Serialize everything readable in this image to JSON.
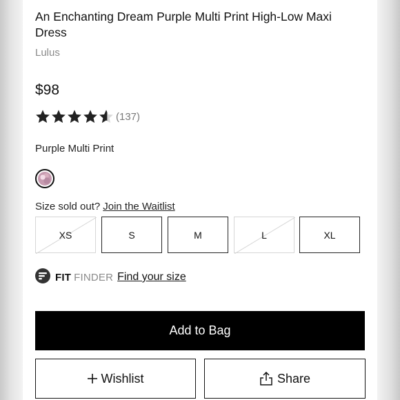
{
  "product": {
    "title": "An Enchanting Dream Purple Multi Print High-Low Maxi Dress",
    "brand": "Lulus",
    "price": "$98",
    "rating": 4.6,
    "rating_count": "(137)",
    "color_name": "Purple Multi Print"
  },
  "sizes": {
    "sold_out_text": "Size sold out?",
    "waitlist_link": "Join the Waitlist",
    "options": [
      {
        "label": "XS",
        "sold_out": true
      },
      {
        "label": "S",
        "sold_out": false
      },
      {
        "label": "M",
        "sold_out": false
      },
      {
        "label": "L",
        "sold_out": true
      },
      {
        "label": "XL",
        "sold_out": false
      }
    ]
  },
  "fit_finder": {
    "brand_bold": "FIT",
    "brand_light": "FINDER",
    "link": "Find your size"
  },
  "actions": {
    "add_to_bag": "Add to Bag",
    "wishlist": "Wishlist",
    "share": "Share"
  },
  "colors": {
    "text": "#111111",
    "muted": "#8a8a8a",
    "button_bg": "#000000",
    "sold_out_border": "#d6d6d6"
  }
}
